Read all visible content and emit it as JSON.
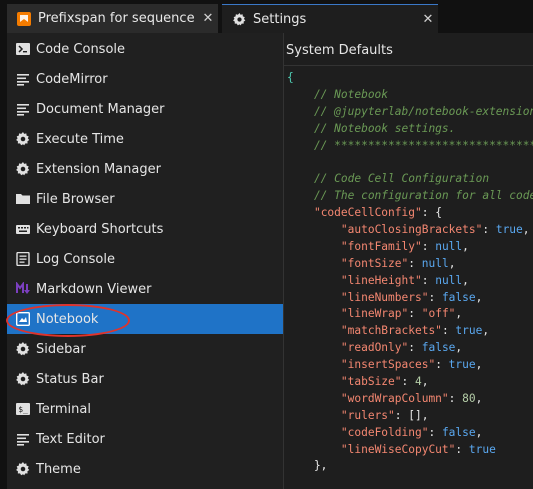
{
  "tabs": [
    {
      "label": "Prefixspan for sequence path",
      "close": "✕",
      "icon": "notebook-icon"
    },
    {
      "label": "Settings",
      "close": "✕",
      "icon": "gear-icon"
    }
  ],
  "sidebar": {
    "items": [
      {
        "label": "Code Console",
        "icon": "console-icon"
      },
      {
        "label": "CodeMirror",
        "icon": "list-icon"
      },
      {
        "label": "Document Manager",
        "icon": "list-icon"
      },
      {
        "label": "Execute Time",
        "icon": "gear-icon"
      },
      {
        "label": "Extension Manager",
        "icon": "gear-icon"
      },
      {
        "label": "File Browser",
        "icon": "folder-icon"
      },
      {
        "label": "Keyboard Shortcuts",
        "icon": "keyboard-icon"
      },
      {
        "label": "Log Console",
        "icon": "log-icon"
      },
      {
        "label": "Markdown Viewer",
        "icon": "markdown-icon"
      },
      {
        "label": "Notebook",
        "icon": "notebook-icon",
        "active": true
      },
      {
        "label": "Sidebar",
        "icon": "gear-icon"
      },
      {
        "label": "Status Bar",
        "icon": "gear-icon"
      },
      {
        "label": "Terminal",
        "icon": "terminal-icon"
      },
      {
        "label": "Text Editor",
        "icon": "list-icon"
      },
      {
        "label": "Theme",
        "icon": "gear-icon"
      }
    ]
  },
  "editor": {
    "title": "System Defaults",
    "lines": [
      [
        {
          "t": "{",
          "c": "brace"
        }
      ],
      [
        {
          "t": "    // Notebook",
          "c": "com"
        }
      ],
      [
        {
          "t": "    // @jupyterlab/notebook-extension:tracker",
          "c": "com"
        }
      ],
      [
        {
          "t": "    // Notebook settings.",
          "c": "com"
        }
      ],
      [
        {
          "t": "    // ********************************",
          "c": "com"
        }
      ],
      [
        {
          "t": "",
          "c": "punc"
        }
      ],
      [
        {
          "t": "    // Code Cell Configuration",
          "c": "com"
        }
      ],
      [
        {
          "t": "    // The configuration for all code cells.",
          "c": "com"
        }
      ],
      [
        {
          "t": "    ",
          "c": "punc"
        },
        {
          "t": "\"codeCellConfig\"",
          "c": "key"
        },
        {
          "t": ": {",
          "c": "punc"
        }
      ],
      [
        {
          "t": "        ",
          "c": "punc"
        },
        {
          "t": "\"autoClosingBrackets\"",
          "c": "key"
        },
        {
          "t": ": ",
          "c": "punc"
        },
        {
          "t": "true",
          "c": "bool"
        },
        {
          "t": ",",
          "c": "punc"
        }
      ],
      [
        {
          "t": "        ",
          "c": "punc"
        },
        {
          "t": "\"fontFamily\"",
          "c": "key"
        },
        {
          "t": ": ",
          "c": "punc"
        },
        {
          "t": "null",
          "c": "bool"
        },
        {
          "t": ",",
          "c": "punc"
        }
      ],
      [
        {
          "t": "        ",
          "c": "punc"
        },
        {
          "t": "\"fontSize\"",
          "c": "key"
        },
        {
          "t": ": ",
          "c": "punc"
        },
        {
          "t": "null",
          "c": "bool"
        },
        {
          "t": ",",
          "c": "punc"
        }
      ],
      [
        {
          "t": "        ",
          "c": "punc"
        },
        {
          "t": "\"lineHeight\"",
          "c": "key"
        },
        {
          "t": ": ",
          "c": "punc"
        },
        {
          "t": "null",
          "c": "bool"
        },
        {
          "t": ",",
          "c": "punc"
        }
      ],
      [
        {
          "t": "        ",
          "c": "punc"
        },
        {
          "t": "\"lineNumbers\"",
          "c": "key"
        },
        {
          "t": ": ",
          "c": "punc"
        },
        {
          "t": "false",
          "c": "bool"
        },
        {
          "t": ",",
          "c": "punc"
        }
      ],
      [
        {
          "t": "        ",
          "c": "punc"
        },
        {
          "t": "\"lineWrap\"",
          "c": "key"
        },
        {
          "t": ": ",
          "c": "punc"
        },
        {
          "t": "\"off\"",
          "c": "str"
        },
        {
          "t": ",",
          "c": "punc"
        }
      ],
      [
        {
          "t": "        ",
          "c": "punc"
        },
        {
          "t": "\"matchBrackets\"",
          "c": "key"
        },
        {
          "t": ": ",
          "c": "punc"
        },
        {
          "t": "true",
          "c": "bool"
        },
        {
          "t": ",",
          "c": "punc"
        }
      ],
      [
        {
          "t": "        ",
          "c": "punc"
        },
        {
          "t": "\"readOnly\"",
          "c": "key"
        },
        {
          "t": ": ",
          "c": "punc"
        },
        {
          "t": "false",
          "c": "bool"
        },
        {
          "t": ",",
          "c": "punc"
        }
      ],
      [
        {
          "t": "        ",
          "c": "punc"
        },
        {
          "t": "\"insertSpaces\"",
          "c": "key"
        },
        {
          "t": ": ",
          "c": "punc"
        },
        {
          "t": "true",
          "c": "bool"
        },
        {
          "t": ",",
          "c": "punc"
        }
      ],
      [
        {
          "t": "        ",
          "c": "punc"
        },
        {
          "t": "\"tabSize\"",
          "c": "key"
        },
        {
          "t": ": ",
          "c": "punc"
        },
        {
          "t": "4",
          "c": "num"
        },
        {
          "t": ",",
          "c": "punc"
        }
      ],
      [
        {
          "t": "        ",
          "c": "punc"
        },
        {
          "t": "\"wordWrapColumn\"",
          "c": "key"
        },
        {
          "t": ": ",
          "c": "punc"
        },
        {
          "t": "80",
          "c": "num"
        },
        {
          "t": ",",
          "c": "punc"
        }
      ],
      [
        {
          "t": "        ",
          "c": "punc"
        },
        {
          "t": "\"rulers\"",
          "c": "key"
        },
        {
          "t": ": [],",
          "c": "punc"
        }
      ],
      [
        {
          "t": "        ",
          "c": "punc"
        },
        {
          "t": "\"codeFolding\"",
          "c": "key"
        },
        {
          "t": ": ",
          "c": "punc"
        },
        {
          "t": "false",
          "c": "bool"
        },
        {
          "t": ",",
          "c": "punc"
        }
      ],
      [
        {
          "t": "        ",
          "c": "punc"
        },
        {
          "t": "\"lineWiseCopyCut\"",
          "c": "key"
        },
        {
          "t": ": ",
          "c": "punc"
        },
        {
          "t": "true",
          "c": "bool"
        }
      ],
      [
        {
          "t": "    },",
          "c": "punc"
        }
      ]
    ]
  },
  "colors": {
    "active_item": "#1f73c7",
    "annotation": "#e0332b",
    "notebook_tab_icon": "#f57c00"
  }
}
